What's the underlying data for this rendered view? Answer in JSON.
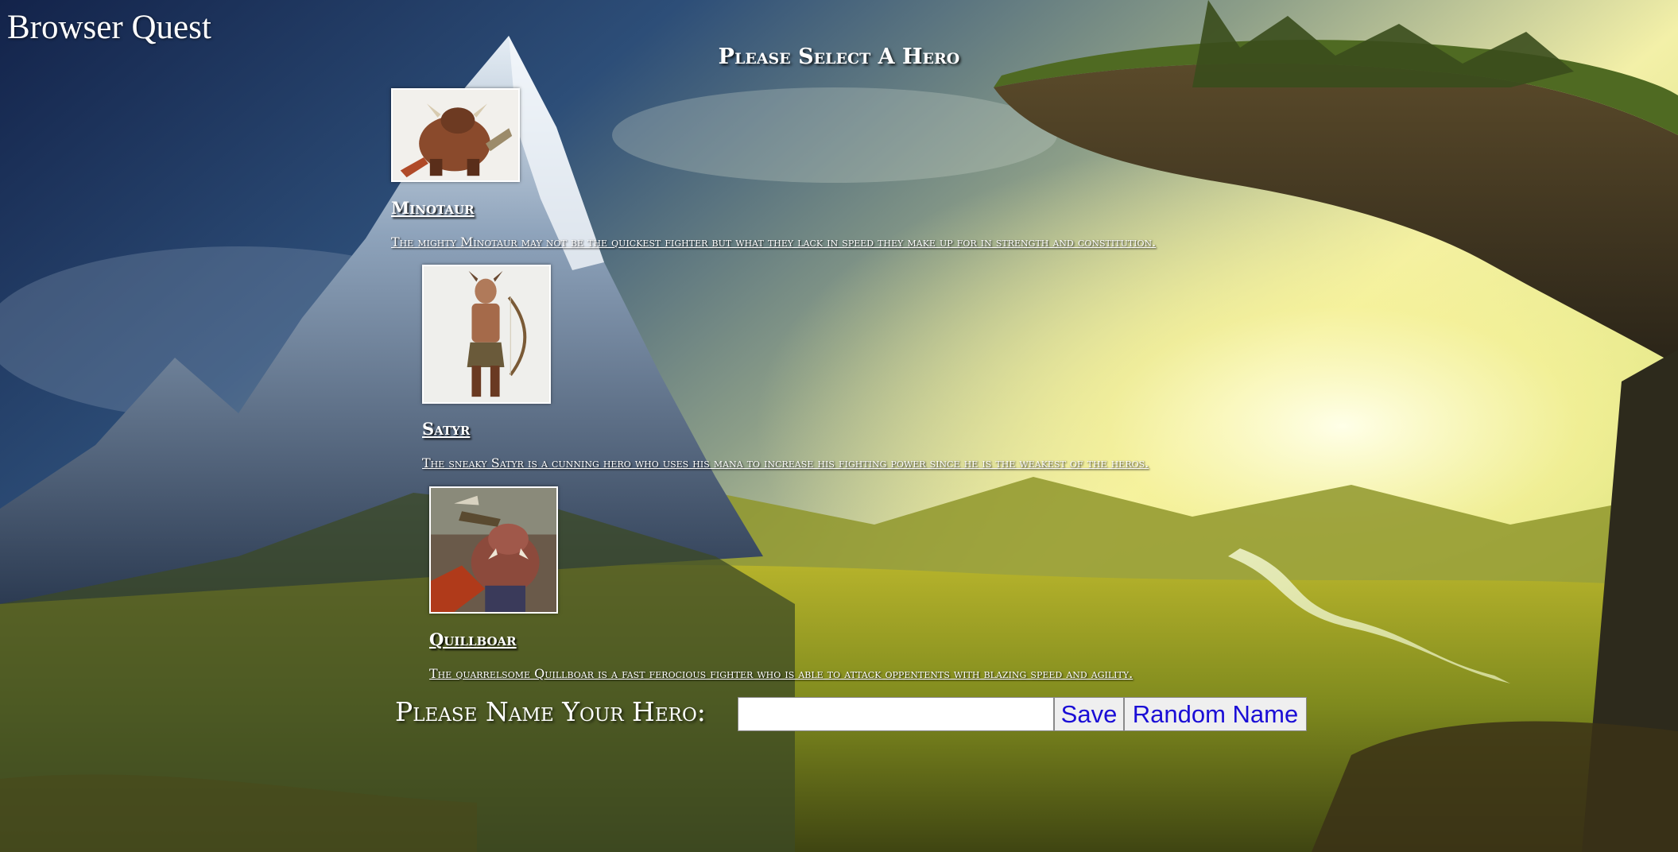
{
  "app": {
    "title": "Browser Quest"
  },
  "page": {
    "heading": "Please Select A Hero"
  },
  "heroes": [
    {
      "name": "Minotaur",
      "description": "The mighty Minotaur may not be the quickest fighter but what they lack in speed they make up for in strength and constitution.",
      "image_alt": "minotaur-portrait"
    },
    {
      "name": "Satyr",
      "description": "The sneaky Satyr is a cunning hero who uses his mana to increase his fighting power since he is the weakest of the heros.",
      "image_alt": "satyr-portrait"
    },
    {
      "name": "Quillboar",
      "description": "The quarrelsome Quillboar is a fast ferocious fighter who is able to attack oppentents with blazing speed and agility.",
      "image_alt": "quillboar-portrait"
    }
  ],
  "naming": {
    "label": "Please Name Your Hero:",
    "input_value": "",
    "save_label": "Save",
    "random_label": "Random Name"
  }
}
